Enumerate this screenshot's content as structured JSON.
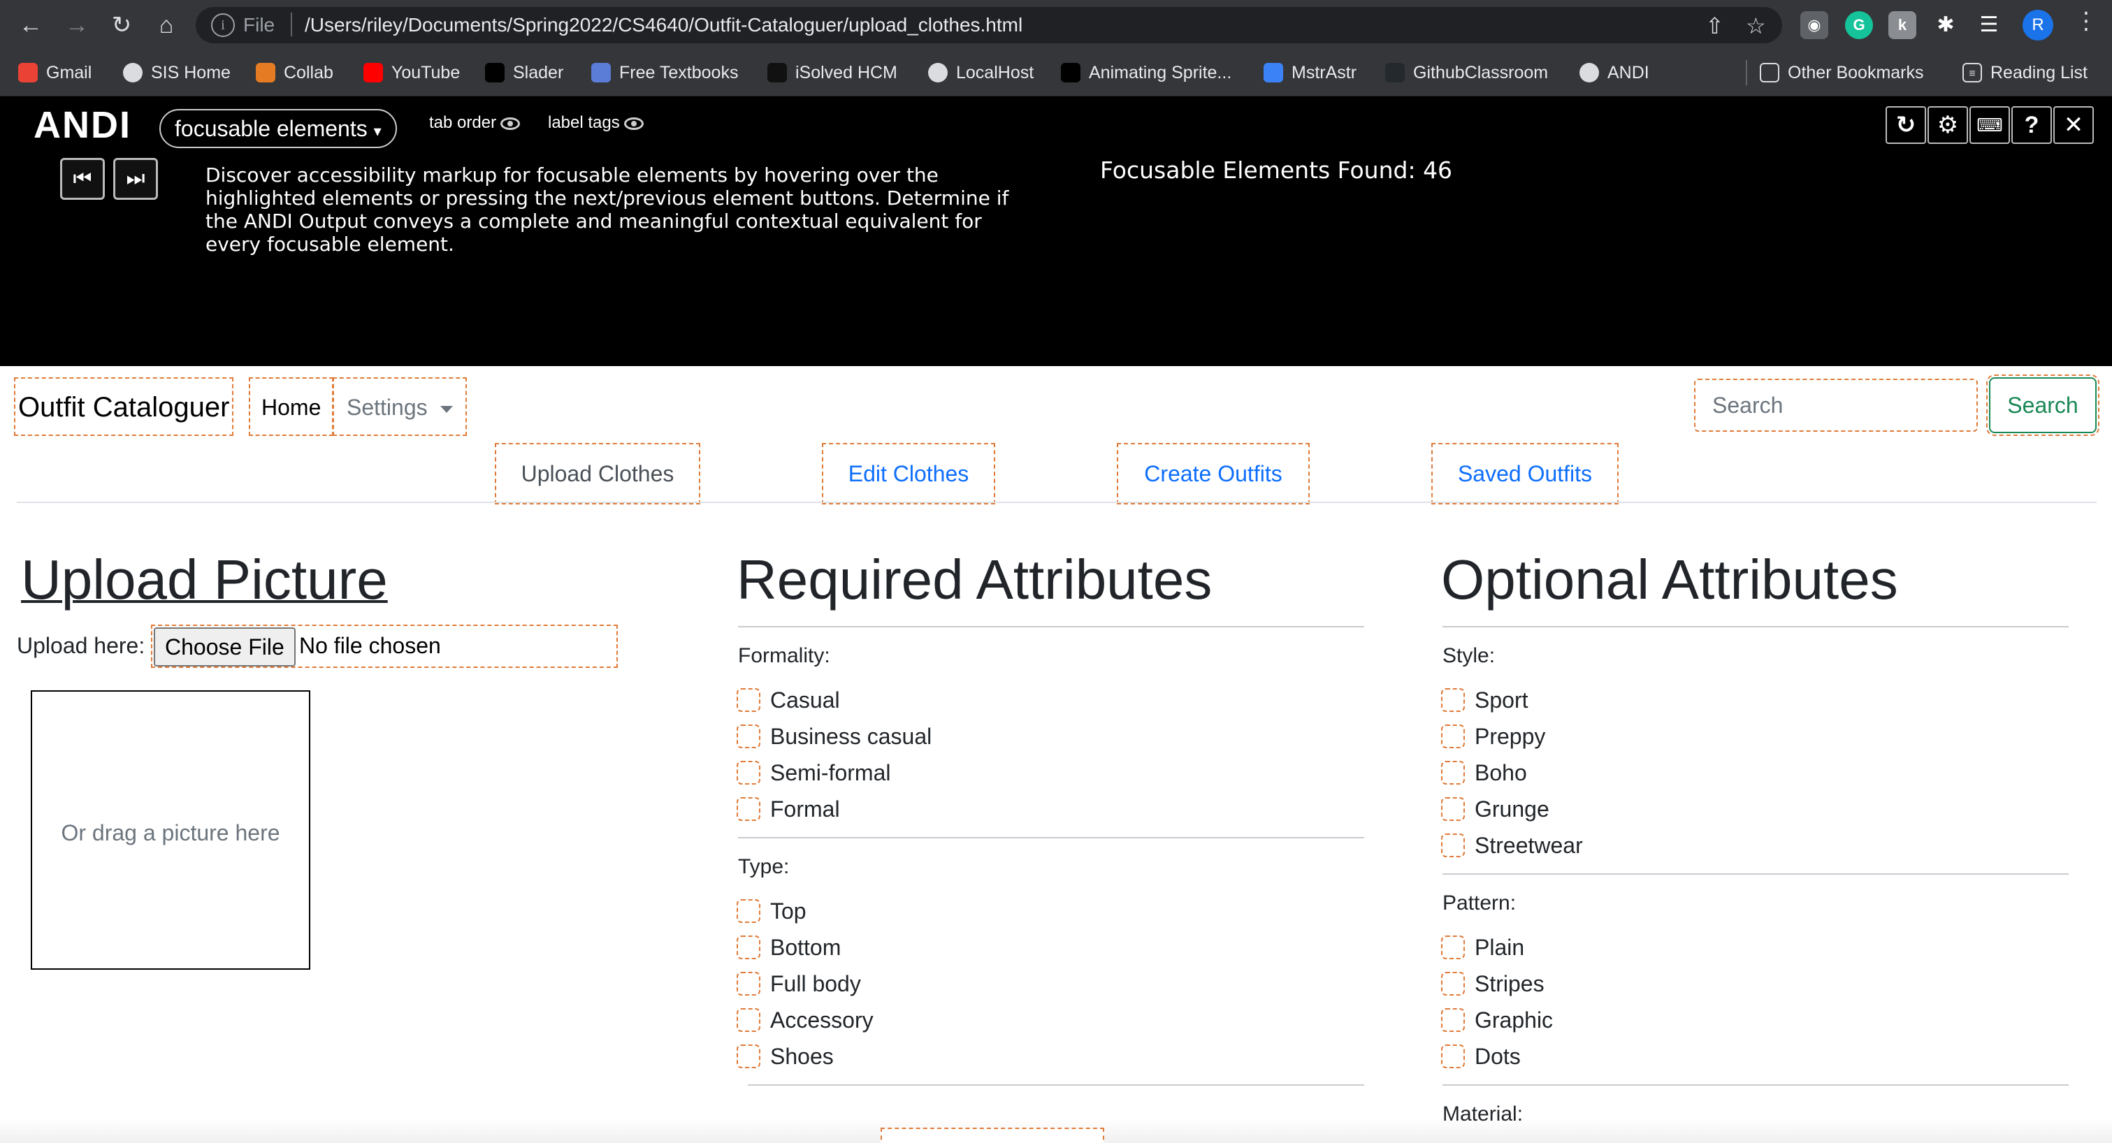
{
  "browser": {
    "url_scheme": "File",
    "url": "/Users/riley/Documents/Spring2022/CS4640/Outfit-Cataloguer/upload_clothes.html",
    "profile_initial": "R",
    "bookmarks": [
      {
        "label": "Gmail",
        "icon": "gmail-icon",
        "color": "#ea4335"
      },
      {
        "label": "SIS Home",
        "icon": "globe-icon",
        "color": "#5f6368"
      },
      {
        "label": "Collab",
        "icon": "collab-icon",
        "color": "#e57c23"
      },
      {
        "label": "YouTube",
        "icon": "youtube-icon",
        "color": "#ff0000"
      },
      {
        "label": "Slader",
        "icon": "slader-icon",
        "color": "#000000"
      },
      {
        "label": "Free Textbooks",
        "icon": "book-icon",
        "color": "#5b7dd8"
      },
      {
        "label": "iSolved HCM",
        "icon": "isolved-icon",
        "color": "#111111"
      },
      {
        "label": "LocalHost",
        "icon": "globe-icon",
        "color": "#5f6368"
      },
      {
        "label": "Animating Sprite...",
        "icon": "dev-icon",
        "color": "#000000"
      },
      {
        "label": "MstrAstr",
        "icon": "mstrastr-icon",
        "color": "#3b82f6"
      },
      {
        "label": "GithubClassroom",
        "icon": "github-icon",
        "color": "#24292e"
      },
      {
        "label": "ANDI",
        "icon": "globe-icon",
        "color": "#5f6368"
      }
    ],
    "other_bookmarks": "Other Bookmarks",
    "reading_list": "Reading List"
  },
  "andi": {
    "logo": "ANDI",
    "module": "focusable elements",
    "tab_order_label": "tab order",
    "label_tags_label": "label tags",
    "description": "Discover accessibility markup for focusable elements by hovering over the highlighted elements or pressing the next/previous element buttons. Determine if the ANDI Output conveys a complete and meaningful contextual equivalent for every focusable element.",
    "found_text": "Focusable Elements Found: 46"
  },
  "nav": {
    "brand": "Outfit Cataloguer",
    "home": "Home",
    "settings": "Settings",
    "search_placeholder": "Search",
    "search_button": "Search"
  },
  "tabs": [
    "Upload Clothes",
    "Edit Clothes",
    "Create Outfits",
    "Saved Outfits"
  ],
  "upload": {
    "title": "Upload Picture",
    "label": "Upload here:",
    "choose_file": "Choose File",
    "file_status": "No file chosen",
    "drop_text": "Or drag a picture here"
  },
  "required": {
    "title": "Required Attributes",
    "formality_label": "Formality:",
    "formality": [
      "Casual",
      "Business casual",
      "Semi-formal",
      "Formal"
    ],
    "type_label": "Type:",
    "type": [
      "Top",
      "Bottom",
      "Full body",
      "Accessory",
      "Shoes"
    ]
  },
  "optional": {
    "title": "Optional Attributes",
    "style_label": "Style:",
    "style": [
      "Sport",
      "Preppy",
      "Boho",
      "Grunge",
      "Streetwear"
    ],
    "pattern_label": "Pattern:",
    "pattern": [
      "Plain",
      "Stripes",
      "Graphic",
      "Dots"
    ],
    "material_label": "Material:"
  },
  "colors": {
    "focus_outline": "#e07b39",
    "link_blue": "#0d6efd",
    "success_green": "#198754"
  }
}
